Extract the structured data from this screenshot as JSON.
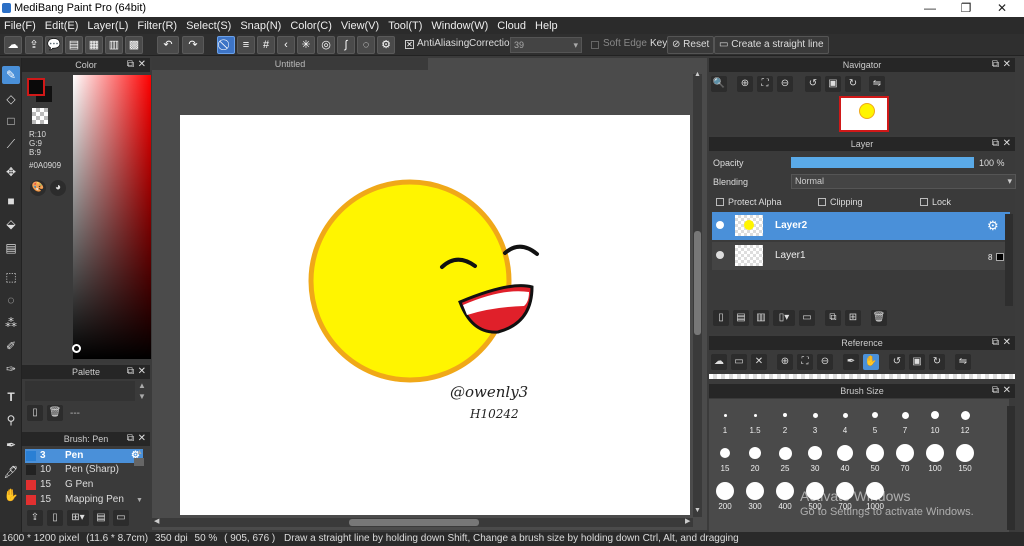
{
  "app": {
    "title": "MediBang Paint Pro (64bit)"
  },
  "window_controls": {
    "minimize": "—",
    "maximize": "❐",
    "close": "✕"
  },
  "menu": [
    "File(F)",
    "Edit(E)",
    "Layer(L)",
    "Filter(R)",
    "Select(S)",
    "Snap(N)",
    "Color(C)",
    "View(V)",
    "Tool(T)",
    "Window(W)",
    "Cloud",
    "Help"
  ],
  "toolbar": {
    "antialiasing_label": "AntiAliasing",
    "correction_label": "Correction",
    "correction_value": "39",
    "soft_edge_label": "Soft Edge",
    "key_label": "Key",
    "reset_label": "Reset",
    "straight_line_label": "Create a straight line"
  },
  "color_panel": {
    "title": "Color",
    "rgb": [
      "R:10",
      "G:9",
      "B:9"
    ],
    "hex": "#0A0909",
    "fg_color": "#0a0909",
    "bg_color": "#ffffff"
  },
  "palette_panel": {
    "title": "Palette",
    "value": "---"
  },
  "brush_panel": {
    "title": "Brush: Pen",
    "items": [
      {
        "size": "3",
        "name": "Pen",
        "color": "#2a7fd4",
        "selected": true
      },
      {
        "size": "10",
        "name": "Pen (Sharp)",
        "color": "#222222",
        "selected": false
      },
      {
        "size": "15",
        "name": "G Pen",
        "color": "#e23030",
        "selected": false
      },
      {
        "size": "15",
        "name": "Mapping Pen",
        "color": "#e23030",
        "selected": false
      }
    ]
  },
  "canvas": {
    "tab_title": "Untitled",
    "signature": "@owenly3",
    "date": "H10242"
  },
  "navigator": {
    "title": "Navigator"
  },
  "layer_panel": {
    "title": "Layer",
    "opacity_label": "Opacity",
    "opacity_value": "100 %",
    "opacity": 1.0,
    "blending_label": "Blending",
    "blending_value": "Normal",
    "protect_alpha": "Protect Alpha",
    "clipping": "Clipping",
    "lock": "Lock",
    "layers": [
      {
        "name": "Layer2",
        "selected": true
      },
      {
        "name": "Layer1",
        "selected": false,
        "badge": "8"
      }
    ]
  },
  "reference": {
    "title": "Reference"
  },
  "brush_size": {
    "title": "Brush Size",
    "sizes": [
      "1",
      "1.5",
      "2",
      "3",
      "4",
      "5",
      "7",
      "10",
      "12",
      "15",
      "20",
      "25",
      "30",
      "40",
      "50",
      "70",
      "100",
      "150",
      "200",
      "300",
      "400",
      "500",
      "700",
      "1000"
    ]
  },
  "watermark": {
    "line1": "Activate Windows",
    "line2": "Go to Settings to activate Windows."
  },
  "status": {
    "size": "1600 * 1200 pixel",
    "cm": "(11.6 * 8.7cm)",
    "dpi": "350 dpi",
    "zoom": "50 %",
    "coords": "( 905, 676 )",
    "hint": "Draw a straight line by holding down Shift, Change a brush size by holding down Ctrl, Alt, and dragging"
  },
  "colors": {
    "accent": "#4a90d9",
    "selected_layer": "#4a90d9",
    "face": "#fff500",
    "face_rim": "#f0a818"
  }
}
